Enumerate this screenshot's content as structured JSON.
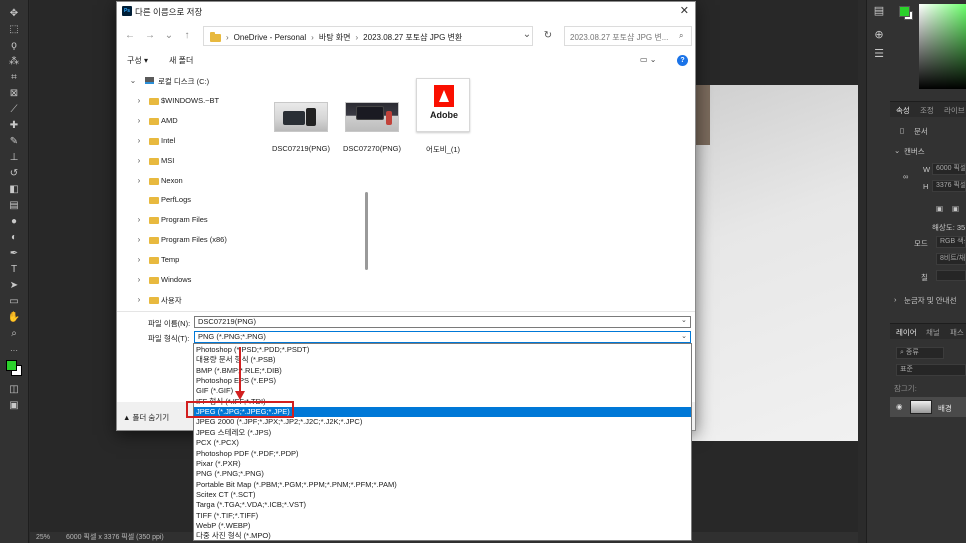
{
  "photoshop": {
    "zoom": "25%",
    "doc_info": "6000 픽셀 x 3376 픽셀 (350 ppi)",
    "tabs_props": [
      "속성",
      "조정",
      "라이브"
    ],
    "doc_label": "문서",
    "canvas_section": "캔버스",
    "width_label": "W",
    "width_value": "6000 픽셀",
    "height_label": "H",
    "height_value": "3376 픽셀",
    "resolution_label": "해상도: 35",
    "mode_label": "모드",
    "mode_value": "RGB 색상",
    "bit_value": "8비트/채",
    "fill_label": "칠",
    "rulers_section": "눈금자 및 안내선",
    "tabs_layers": [
      "레이어",
      "채널",
      "패스"
    ],
    "layer_search": "종류",
    "blend_mode": "표준",
    "lock_label": "잠그기:",
    "layer_name": "배경",
    "fg_color": "#2bd12b",
    "bg_color": "#ffffff"
  },
  "dialog": {
    "title": "다른 이름으로 저장",
    "breadcrumbs": [
      "OneDrive - Personal",
      "바탕 화면",
      "2023.08.27 포토샵 JPG 변환"
    ],
    "search_placeholder": "2023.08.27 포토샵 JPG 변...",
    "organize": "구성 ▾",
    "new_folder": "새 폴더",
    "tree": [
      {
        "label": "로컬 디스크 (C:)",
        "type": "drive",
        "expanded": true
      },
      {
        "label": "$WINDOWS.~BT",
        "type": "folder",
        "chevron": true
      },
      {
        "label": "AMD",
        "type": "folder",
        "chevron": true
      },
      {
        "label": "Intel",
        "type": "folder",
        "chevron": true
      },
      {
        "label": "MSI",
        "type": "folder",
        "chevron": true
      },
      {
        "label": "Nexon",
        "type": "folder",
        "chevron": true
      },
      {
        "label": "PerfLogs",
        "type": "folder",
        "chevron": false
      },
      {
        "label": "Program Files",
        "type": "folder",
        "chevron": true
      },
      {
        "label": "Program Files (x86)",
        "type": "folder",
        "chevron": true
      },
      {
        "label": "Temp",
        "type": "folder",
        "chevron": true
      },
      {
        "label": "Windows",
        "type": "folder",
        "chevron": true
      },
      {
        "label": "사용자",
        "type": "folder",
        "chevron": true
      }
    ],
    "files": [
      {
        "name": "DSC07219(PNG)",
        "kind": "photo1"
      },
      {
        "name": "DSC07270(PNG)",
        "kind": "photo2"
      },
      {
        "name": "어도비_(1)",
        "kind": "adobe",
        "logo_text": "Adobe"
      }
    ],
    "filename_label": "파일 이름(N):",
    "filename_value": "DSC07219(PNG)",
    "filetype_label": "파일 형식(T):",
    "filetype_value": "PNG (*.PNG;*.PNG)",
    "hide_folders": "▲ 폴더 숨기기",
    "filetype_options": [
      "Photoshop (*.PSD;*.PDD;*.PSDT)",
      "대용량 문서 형식 (*.PSB)",
      "BMP (*.BMP;*.RLE;*.DIB)",
      "Photoshop EPS (*.EPS)",
      "GIF (*.GIF)",
      "IFF 형식 (*.IFF;*.TDI)",
      "JPEG (*.JPG;*.JPEG;*.JPE)",
      "JPEG 2000 (*.JPF;*.JPX;*.JP2;*.J2C;*.J2K;*.JPC)",
      "JPEG 스테레오 (*.JPS)",
      "PCX (*.PCX)",
      "Photoshop PDF (*.PDF;*.PDP)",
      "Pixar (*.PXR)",
      "PNG (*.PNG;*.PNG)",
      "Portable Bit Map (*.PBM;*.PGM;*.PPM;*.PNM;*.PFM;*.PAM)",
      "Scitex CT (*.SCT)",
      "Targa (*.TGA;*.VDA;*.ICB;*.VST)",
      "TIFF (*.TIF;*.TIFF)",
      "WebP (*.WEBP)",
      "다중 사진 형식 (*.MPO)"
    ],
    "selected_option": 6
  }
}
